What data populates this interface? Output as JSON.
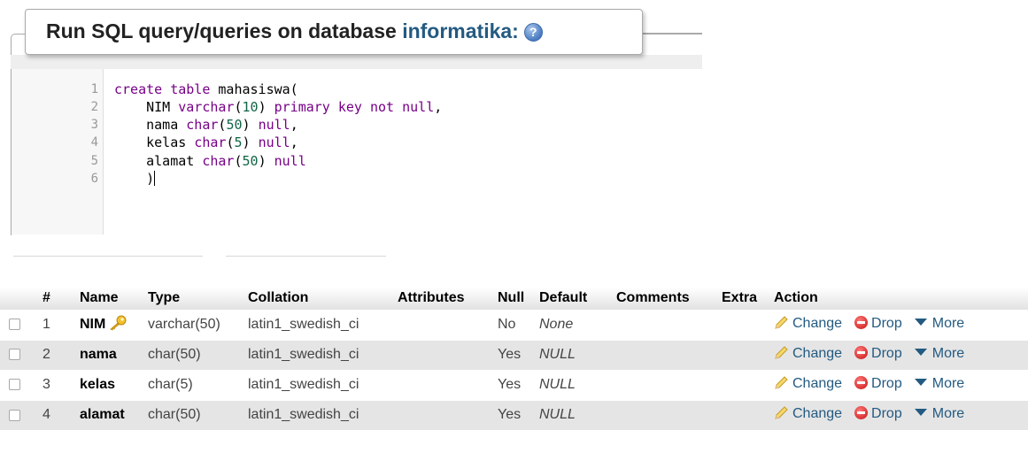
{
  "panel": {
    "legend_prefix": "Run SQL query/queries on database ",
    "database": "informatika:",
    "help_icon": "help-icon"
  },
  "editor": {
    "line_numbers": [
      "1",
      "2",
      "3",
      "4",
      "5",
      "6"
    ]
  },
  "table": {
    "headers": {
      "num": "#",
      "name": "Name",
      "type": "Type",
      "collation": "Collation",
      "attributes": "Attributes",
      "null": "Null",
      "default": "Default",
      "comments": "Comments",
      "extra": "Extra",
      "action": "Action"
    },
    "rows": [
      {
        "num": "1",
        "name": "NIM",
        "type": "varchar(50)",
        "collation": "latin1_swedish_ci",
        "null": "No",
        "default": "None"
      },
      {
        "num": "2",
        "name": "nama",
        "type": "char(50)",
        "collation": "latin1_swedish_ci",
        "null": "Yes",
        "default": "NULL"
      },
      {
        "num": "3",
        "name": "kelas",
        "type": "char(5)",
        "collation": "latin1_swedish_ci",
        "null": "Yes",
        "default": "NULL"
      },
      {
        "num": "4",
        "name": "alamat",
        "type": "char(50)",
        "collation": "latin1_swedish_ci",
        "null": "Yes",
        "default": "NULL"
      }
    ],
    "actions": {
      "change": "Change",
      "drop": "Drop",
      "more": "More"
    }
  },
  "colors": {
    "link": "#235a81",
    "keyword": "#770088",
    "number": "#116644",
    "row_alt": "#e5e5e5"
  }
}
